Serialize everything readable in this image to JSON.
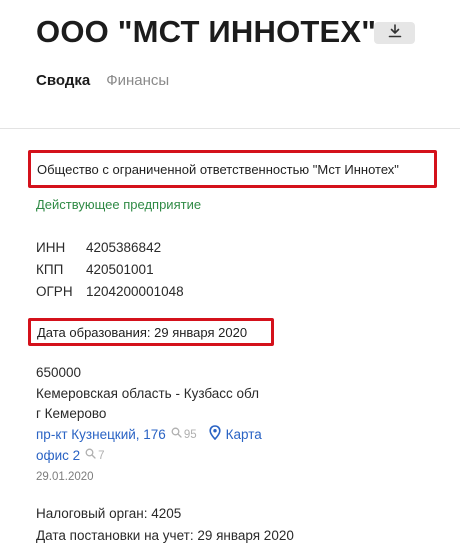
{
  "header": {
    "title": "ООО \"МСТ ИННОТЕХ\"",
    "download_icon": "download-icon"
  },
  "tabs": [
    {
      "label": "Сводка",
      "active": true
    },
    {
      "label": "Финансы",
      "active": false
    }
  ],
  "company": {
    "full_name": "Общество с ограниченной ответственностью \"Мст Иннотех\"",
    "status": "Действующее предприятие",
    "ids": [
      {
        "key": "ИНН",
        "value": "4205386842"
      },
      {
        "key": "КПП",
        "value": "420501001"
      },
      {
        "key": "ОГРН",
        "value": "1204200001048"
      }
    ],
    "registration_date": "Дата образования: 29 января 2020"
  },
  "address": {
    "postcode": "650000",
    "region": "Кемеровская область - Кузбасс обл",
    "city": "г Кемерово",
    "street_link": "пр-кт Кузнецкий, 176",
    "street_count": "95",
    "map_link": "Карта",
    "office_link": "офис 2",
    "office_count": "7",
    "date": "29.01.2020"
  },
  "tax": {
    "authority": "Налоговый орган: 4205",
    "registered": "Дата постановки на учет: 29 января 2020"
  },
  "colors": {
    "highlight_border": "#d4111b",
    "status_green": "#2f8a45",
    "link_blue": "#2a63c4"
  }
}
